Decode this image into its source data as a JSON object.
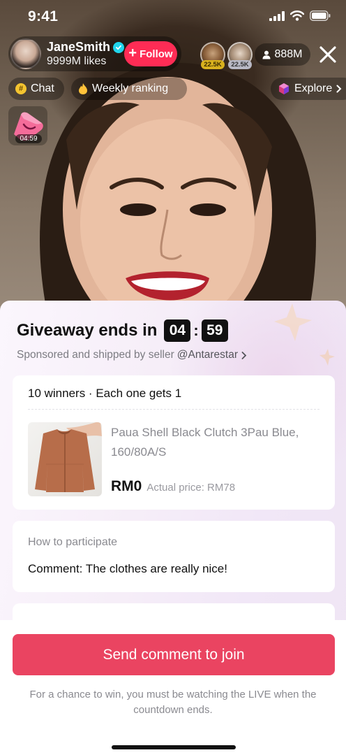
{
  "status_bar": {
    "time": "9:41"
  },
  "host": {
    "name": "JaneSmith",
    "likes": "9999M likes",
    "follow_label": "Follow"
  },
  "viewers": {
    "top": [
      {
        "badge": "22.5K"
      },
      {
        "badge": "22.5K"
      }
    ],
    "count": "888M"
  },
  "pills": {
    "chat": "Chat",
    "ranking": "Weekly ranking",
    "explore": "Explore"
  },
  "gift": {
    "timer": "04:59"
  },
  "giveaway": {
    "title": "Giveaway ends in",
    "minutes": "04",
    "seconds": "59",
    "seller_prefix": "Sponsored and shipped by seller",
    "seller_handle": "@Antarestar",
    "winners": "10 winners · Each one gets 1",
    "product_name": "Paua Shell Black Clutch 3Pau Blue, 160/80A/S",
    "price": "RM0",
    "actual_price": "Actual price: RM78",
    "howto_label": "How to participate",
    "comment": "Comment: The clothes are really nice!",
    "join_button": "Send comment to join",
    "disclaimer": "For a chance to win, you must be watching the LIVE when the countdown ends."
  },
  "colors": {
    "accent": "#fe2c55",
    "join": "#ea4461",
    "verified": "#20d5ec"
  }
}
